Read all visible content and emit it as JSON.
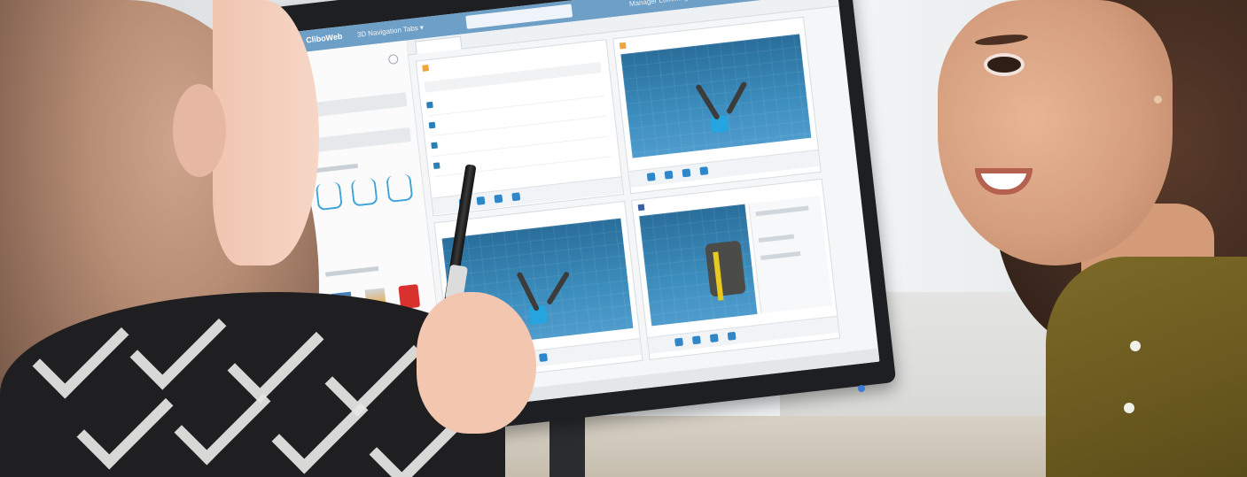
{
  "screen": {
    "app_brand": "CliboWeb",
    "breadcrumb": "3D Navigation Tabs ▾",
    "user_name": "Manager Lommington"
  },
  "colors": {
    "topbar": "#6e9fc6",
    "viewport": "#3b8dbd",
    "accent_blue": "#2f86c9",
    "shirt": "#6a5a1f",
    "pattern_dark": "#1f1f22",
    "pattern_light": "#e8e8e6"
  },
  "icons": [
    "search-icon",
    "cube-icon",
    "robot-arm-icon",
    "app-tile-icon",
    "pen-icon"
  ]
}
